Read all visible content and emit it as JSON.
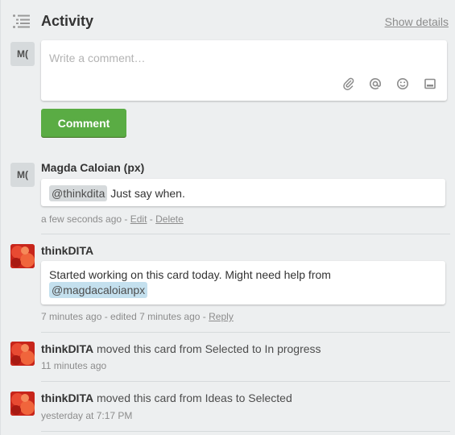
{
  "header": {
    "title": "Activity",
    "show_details": "Show details"
  },
  "composer": {
    "avatar_initials": "M(",
    "placeholder": "Write a comment…",
    "tools": [
      "attachment-icon",
      "mention-icon",
      "emoji-icon",
      "card-icon"
    ],
    "submit_label": "Comment"
  },
  "activities": [
    {
      "avatar_initials": "M(",
      "author": "Magda Caloian (px)",
      "mention": "@thinkdita",
      "text": " Just say when.",
      "time": "a few seconds ago",
      "sep1": " - ",
      "edit": "Edit",
      "sep2": " - ",
      "delete": "Delete"
    },
    {
      "author": "thinkDITA",
      "text": "Started working on this card today. Might need help from",
      "mention": "@magdacaloianpx",
      "time": "7 minutes ago - edited 7 minutes ago",
      "sep": " - ",
      "reply": "Reply"
    },
    {
      "author": "thinkDITA",
      "action": " moved this card from Selected to In progress",
      "time": "11 minutes ago"
    },
    {
      "author": "thinkDITA",
      "action": " moved this card from Ideas to Selected",
      "time": "yesterday at 7:17 PM"
    }
  ],
  "colors": {
    "background": "#edeff0",
    "button": "#5aac44",
    "avatar_red": "#c7251b",
    "mention": "#d6dadc",
    "mention_self": "#c4e0ee"
  }
}
